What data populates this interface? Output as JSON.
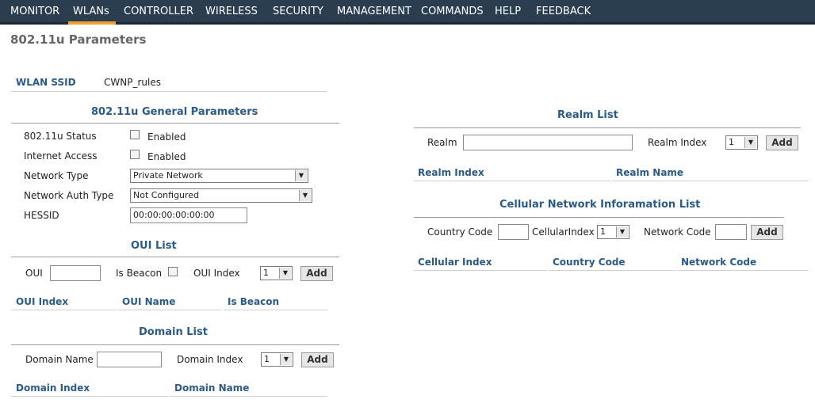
{
  "nav": {
    "items": [
      "MONITOR",
      "WLANs",
      "CONTROLLER",
      "WIRELESS",
      "SECURITY",
      "MANAGEMENT",
      "COMMANDS",
      "HELP",
      "FEEDBACK"
    ],
    "active": "WLANs"
  },
  "page_title": "802.11u Parameters",
  "wlan": {
    "ssid_label": "WLAN SSID",
    "ssid_value": "CWNP_rules"
  },
  "general": {
    "title": "802.11u General Parameters",
    "status_label": "802.11u Status",
    "status_checkbox_label": "Enabled",
    "internet_label": "Internet Access",
    "internet_checkbox_label": "Enabled",
    "network_type_label": "Network Type",
    "network_type_value": "Private Network",
    "network_auth_label": "Network Auth Type",
    "network_auth_value": "Not Configured",
    "hessid_label": "HESSID",
    "hessid_value": "00:00:00:00:00:00"
  },
  "oui": {
    "title": "OUI List",
    "oui_label": "OUI",
    "oui_value": "",
    "is_beacon_label": "Is Beacon",
    "index_label": "OUI Index",
    "index_value": "1",
    "add_label": "Add",
    "columns": [
      "OUI Index",
      "OUI Name",
      "Is Beacon"
    ]
  },
  "domain": {
    "title": "Domain List",
    "name_label": "Domain Name",
    "name_value": "",
    "index_label": "Domain Index",
    "index_value": "1",
    "add_label": "Add",
    "columns": [
      "Domain Index",
      "Domain Name"
    ]
  },
  "realm": {
    "title": "Realm List",
    "realm_label": "Realm",
    "realm_value": "",
    "index_label": "Realm Index",
    "index_value": "1",
    "add_label": "Add",
    "columns": [
      "Realm Index",
      "Realm Name"
    ]
  },
  "cellular": {
    "title": "Cellular Network Inforamation List",
    "country_label": "Country Code",
    "country_value": "",
    "cellindex_label": "CellularIndex",
    "cellindex_value": "1",
    "network_label": "Network Code",
    "network_value": "",
    "add_label": "Add",
    "columns": [
      "Cellular Index",
      "Country Code",
      "Network Code"
    ]
  },
  "colors": {
    "nav_bg": "#2b3e50",
    "nav_active": "#f0a030",
    "heading": "#2a5a8a"
  }
}
